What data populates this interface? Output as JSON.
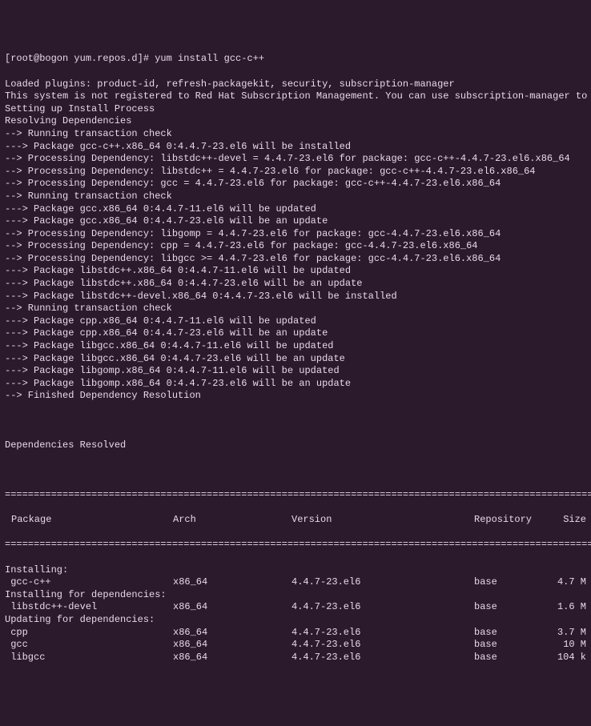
{
  "prompt": "[root@bogon yum.repos.d]# yum install gcc-c++",
  "lines": [
    "Loaded plugins: product-id, refresh-packagekit, security, subscription-manager",
    "This system is not registered to Red Hat Subscription Management. You can use subscription-manager to register.",
    "Setting up Install Process",
    "Resolving Dependencies",
    "--> Running transaction check",
    "---> Package gcc-c++.x86_64 0:4.4.7-23.el6 will be installed",
    "--> Processing Dependency: libstdc++-devel = 4.4.7-23.el6 for package: gcc-c++-4.4.7-23.el6.x86_64",
    "--> Processing Dependency: libstdc++ = 4.4.7-23.el6 for package: gcc-c++-4.4.7-23.el6.x86_64",
    "--> Processing Dependency: gcc = 4.4.7-23.el6 for package: gcc-c++-4.4.7-23.el6.x86_64",
    "--> Running transaction check",
    "---> Package gcc.x86_64 0:4.4.7-11.el6 will be updated",
    "---> Package gcc.x86_64 0:4.4.7-23.el6 will be an update",
    "--> Processing Dependency: libgomp = 4.4.7-23.el6 for package: gcc-4.4.7-23.el6.x86_64",
    "--> Processing Dependency: cpp = 4.4.7-23.el6 for package: gcc-4.4.7-23.el6.x86_64",
    "--> Processing Dependency: libgcc >= 4.4.7-23.el6 for package: gcc-4.4.7-23.el6.x86_64",
    "---> Package libstdc++.x86_64 0:4.4.7-11.el6 will be updated",
    "---> Package libstdc++.x86_64 0:4.4.7-23.el6 will be an update",
    "---> Package libstdc++-devel.x86_64 0:4.4.7-23.el6 will be installed",
    "--> Running transaction check",
    "---> Package cpp.x86_64 0:4.4.7-11.el6 will be updated",
    "---> Package cpp.x86_64 0:4.4.7-23.el6 will be an update",
    "---> Package libgcc.x86_64 0:4.4.7-11.el6 will be updated",
    "---> Package libgcc.x86_64 0:4.4.7-23.el6 will be an update",
    "---> Package libgomp.x86_64 0:4.4.7-11.el6 will be updated",
    "---> Package libgomp.x86_64 0:4.4.7-23.el6 will be an update",
    "--> Finished Dependency Resolution"
  ],
  "deps_header": "Dependencies Resolved",
  "rule": "==========================================================================================================",
  "table": {
    "headers": {
      "pkg": "Package",
      "arch": "Arch",
      "ver": "Version",
      "repo": "Repository",
      "size": "Size"
    },
    "sections": [
      {
        "label": "Installing:",
        "rows": [
          {
            "pkg": " gcc-c++",
            "arch": "x86_64",
            "ver": "4.4.7-23.el6",
            "repo": "base",
            "size": "4.7 M"
          }
        ]
      },
      {
        "label": "Installing for dependencies:",
        "rows": [
          {
            "pkg": " libstdc++-devel",
            "arch": "x86_64",
            "ver": "4.4.7-23.el6",
            "repo": "base",
            "size": "1.6 M"
          }
        ]
      },
      {
        "label": "Updating for dependencies:",
        "rows": [
          {
            "pkg": " cpp",
            "arch": "x86_64",
            "ver": "4.4.7-23.el6",
            "repo": "base",
            "size": "3.7 M"
          },
          {
            "pkg": " gcc",
            "arch": "x86_64",
            "ver": "4.4.7-23.el6",
            "repo": "base",
            "size": "10 M"
          },
          {
            "pkg": " libgcc",
            "arch": "x86_64",
            "ver": "4.4.7-23.el6",
            "repo": "base",
            "size": "104 k"
          }
        ]
      }
    ]
  }
}
